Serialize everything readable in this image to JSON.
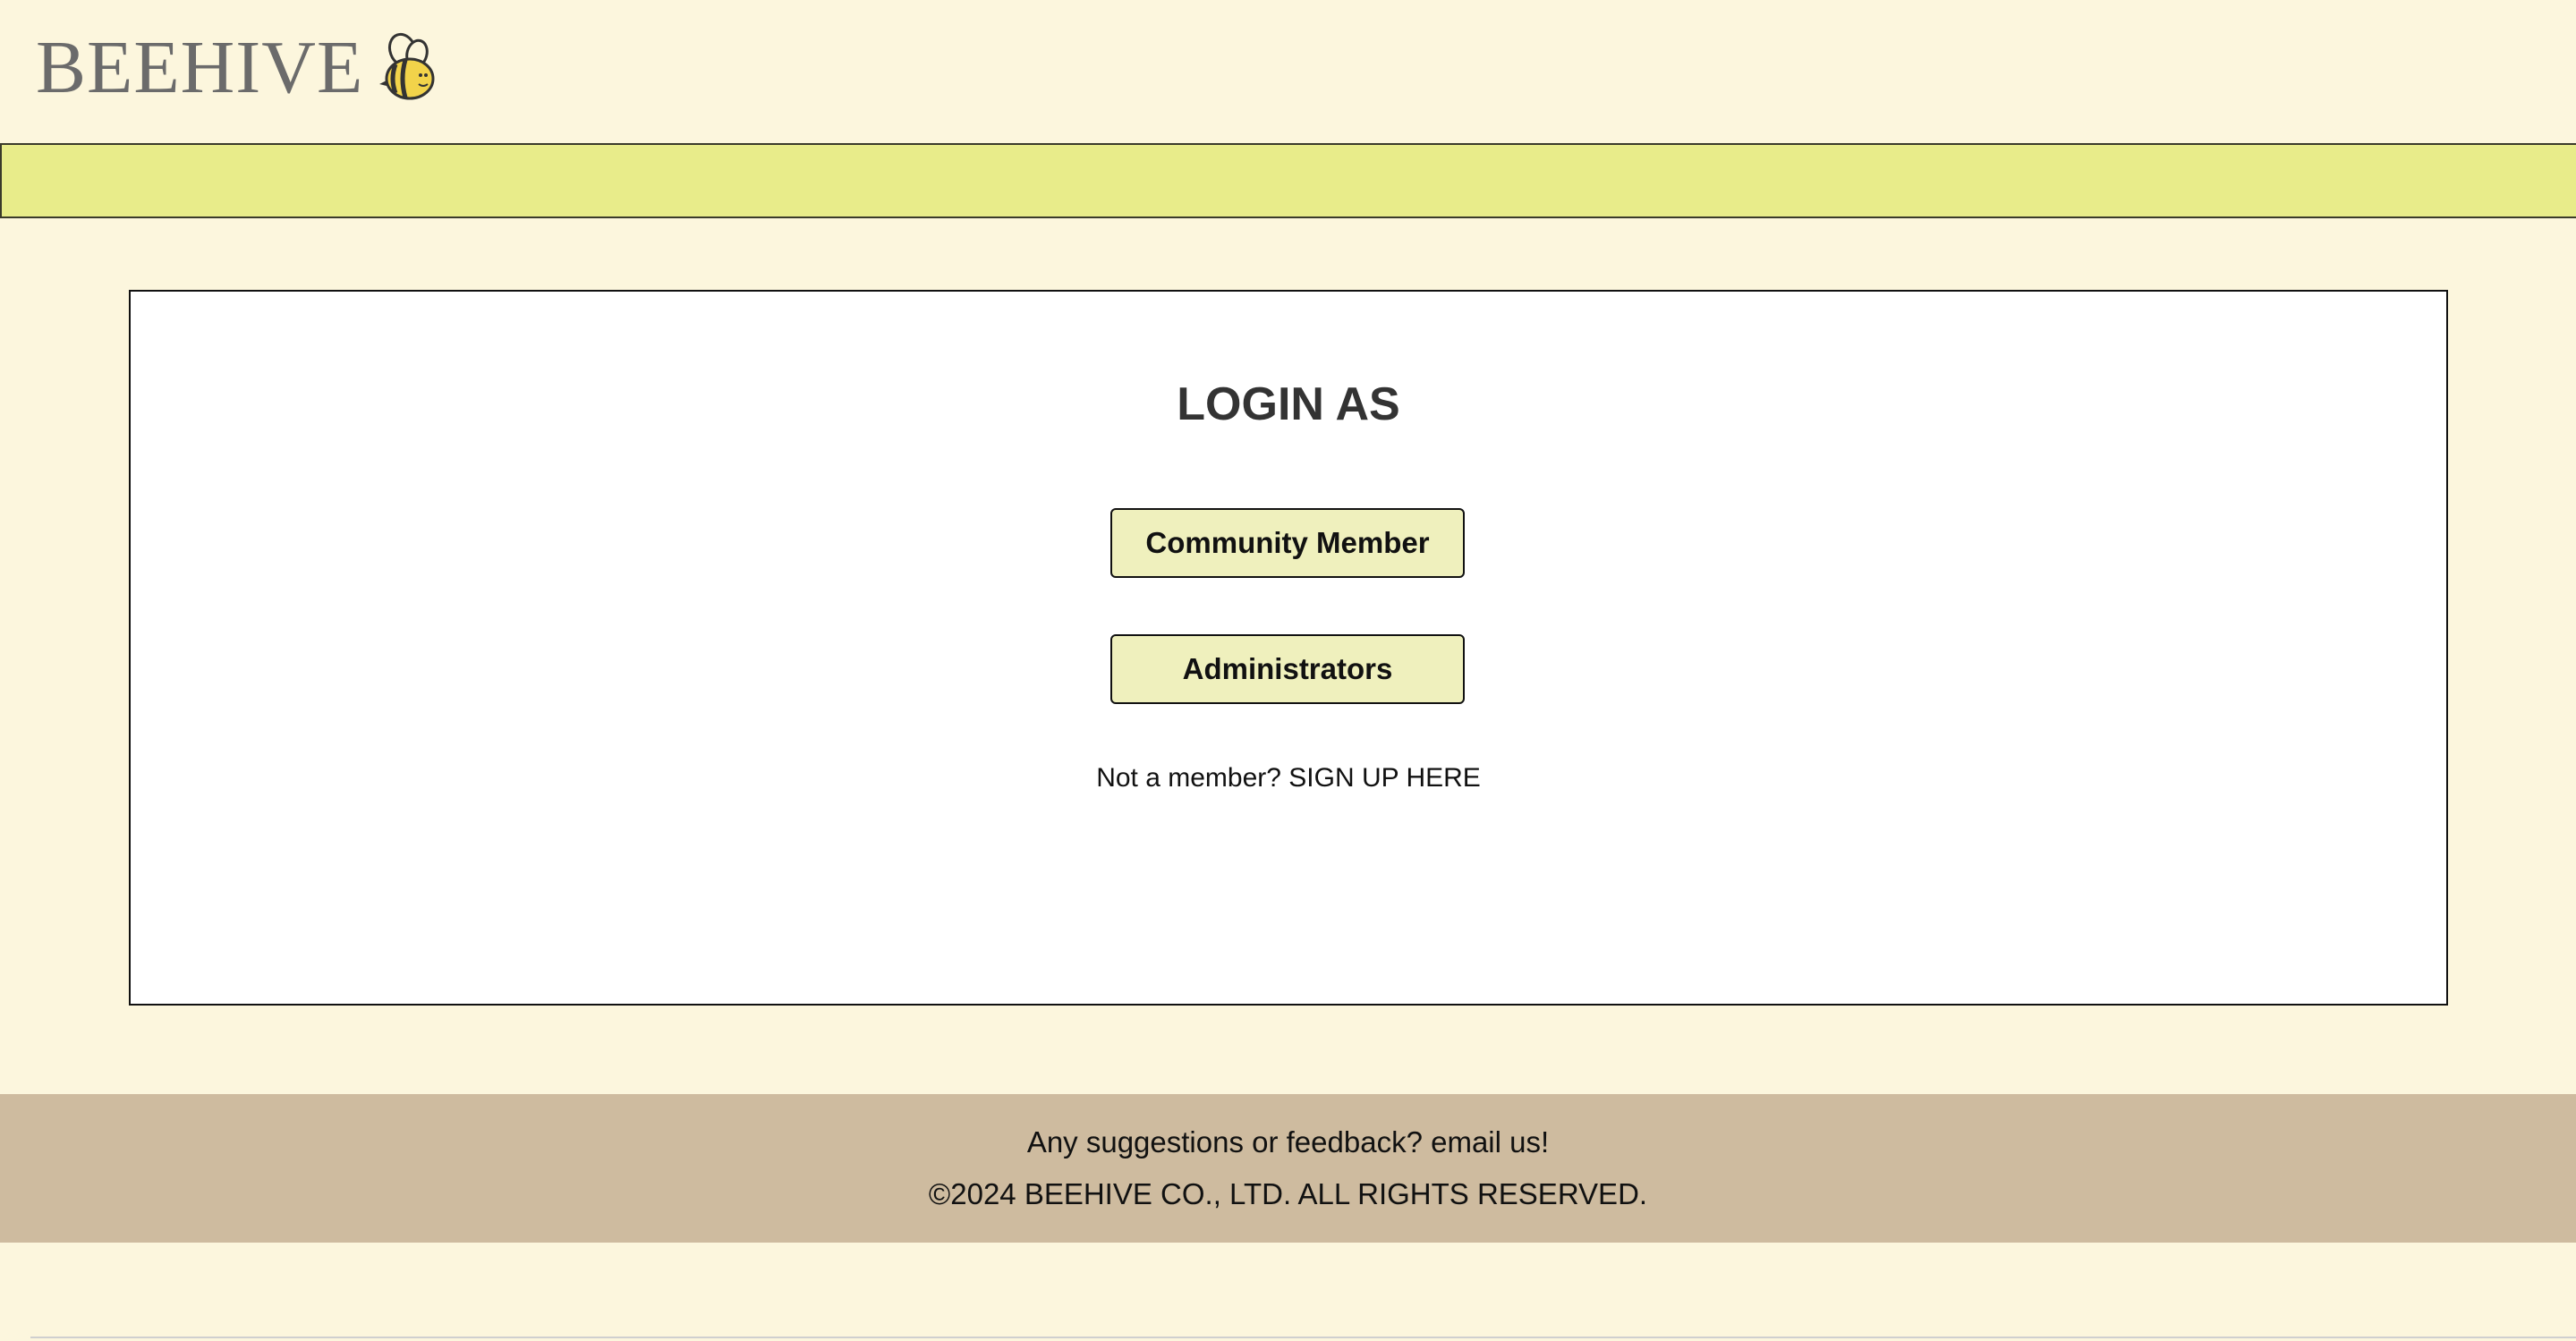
{
  "header": {
    "logo_text": "BEEHIVE",
    "logo_icon": "bee-icon"
  },
  "login": {
    "title": "LOGIN AS",
    "community_member_label": "Community Member",
    "administrators_label": "Administrators",
    "signup_prompt": "Not a member?",
    "signup_link": "SIGN UP HERE"
  },
  "footer": {
    "feedback_prompt": "Any suggestions or feedback?",
    "feedback_link": "email us!",
    "copyright": "©2024 BEEHIVE CO., LTD. ALL RIGHTS RESERVED."
  },
  "colors": {
    "page_background": "#fcf6dd",
    "navbar_background": "#e8ec8a",
    "button_background": "#eff0bd",
    "footer_background": "#cebb9f",
    "logo_text": "#6b6b6b"
  }
}
